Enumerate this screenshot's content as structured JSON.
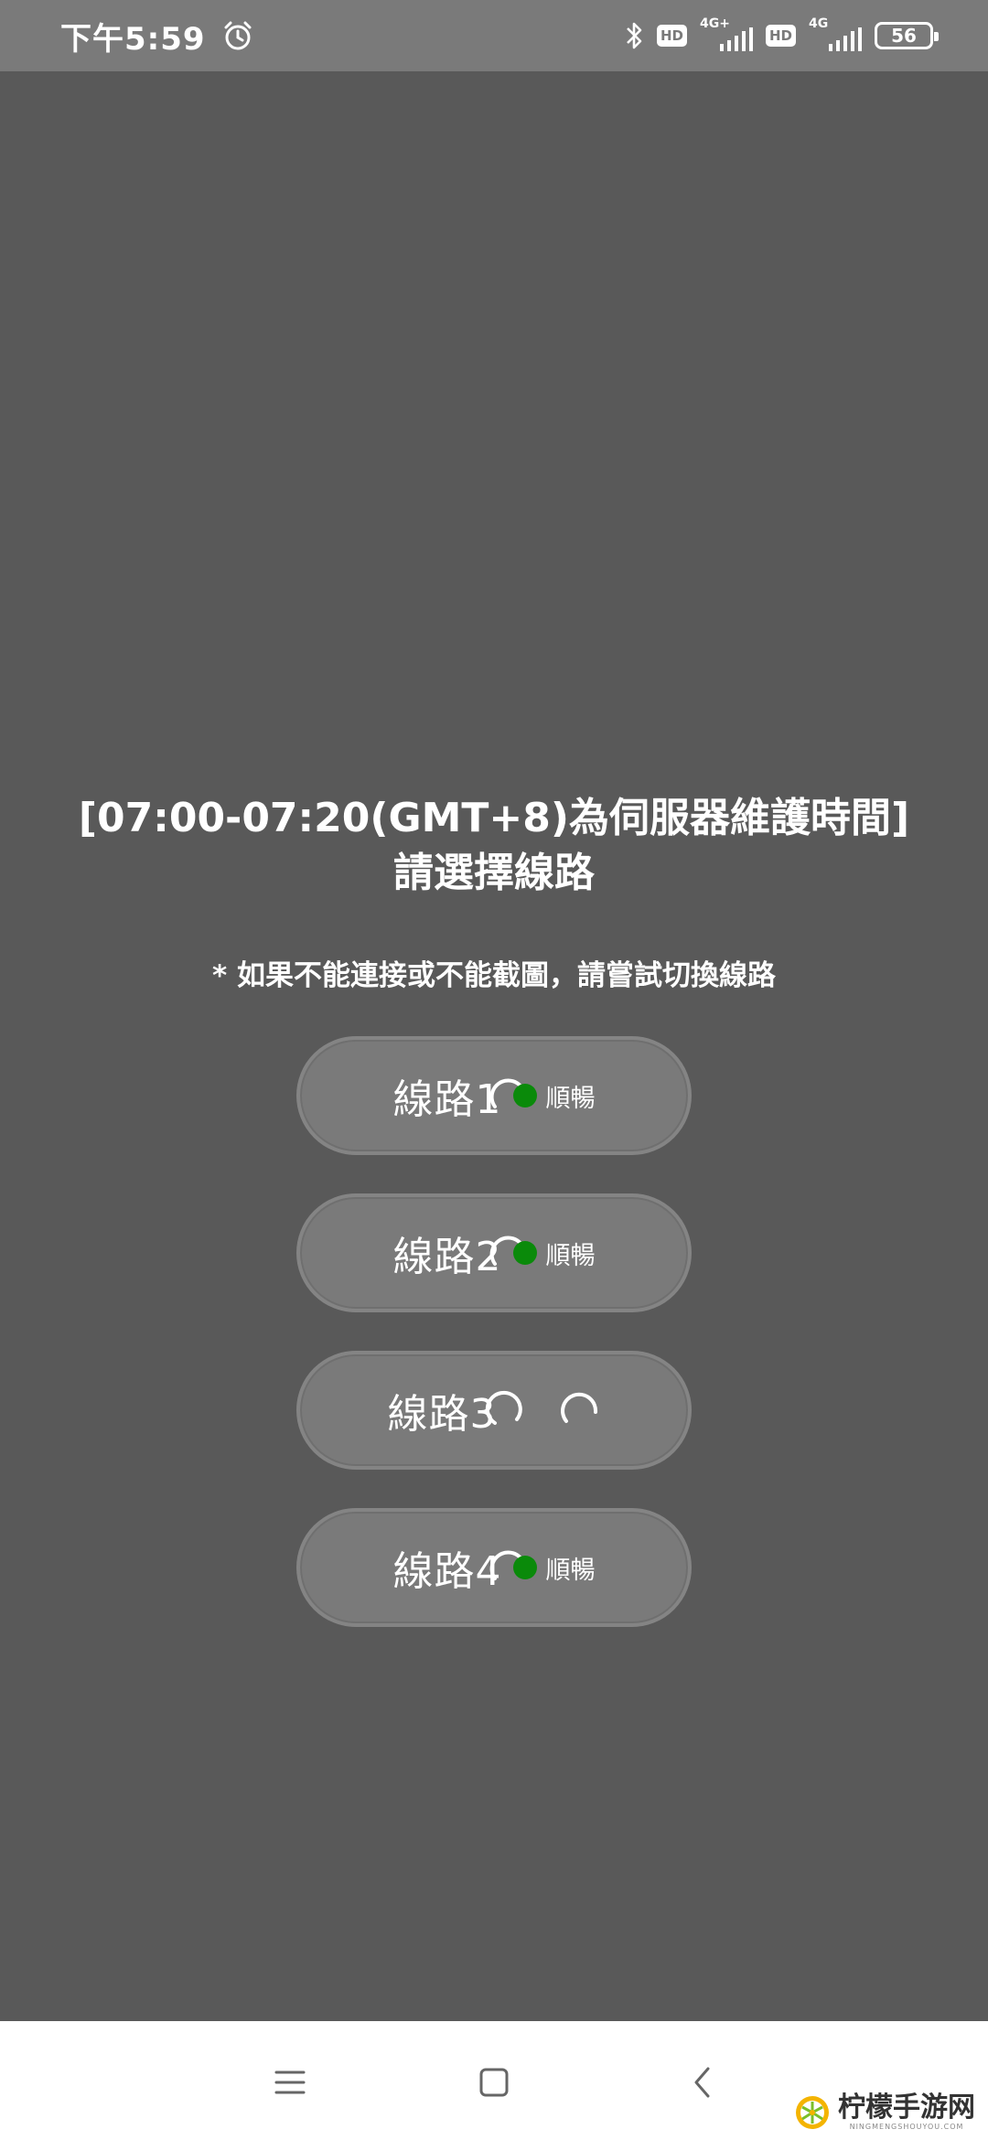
{
  "status_bar": {
    "time": "下午5:59",
    "network1_type": "4G+",
    "network2_type": "4G",
    "hd_label": "HD",
    "battery_level": "56"
  },
  "content": {
    "title_line1": "[07:00-07:20(GMT+8)為伺服器維護時間]",
    "title_line2": "請選擇線路",
    "notice": "* 如果不能連接或不能截圖，請嘗試切換線路"
  },
  "routes": [
    {
      "label": "線路1",
      "status": "順暢",
      "status_color": "#0a8a0a"
    },
    {
      "label": "線路2",
      "status": "順暢",
      "status_color": "#0a8a0a"
    },
    {
      "label": "線路3",
      "status": null
    },
    {
      "label": "線路4",
      "status": "順暢",
      "status_color": "#0a8a0a"
    }
  ],
  "watermark": {
    "title": "柠檬手游网",
    "subtitle": "NINGMENGSHOUYOU.COM"
  },
  "icons": {
    "alarm": "alarm-clock-icon",
    "bluetooth": "bluetooth-icon",
    "signal": "signal-bars-icon",
    "battery": "battery-icon",
    "spinner": "loading-spinner-icon",
    "nav_menu": "menu-lines-icon",
    "nav_home": "home-square-icon",
    "nav_back": "back-chevron-icon"
  },
  "colors": {
    "overlay_bg": "#595959",
    "button_bg": "#7a7a7a",
    "status_ok": "#0a8a0a"
  }
}
